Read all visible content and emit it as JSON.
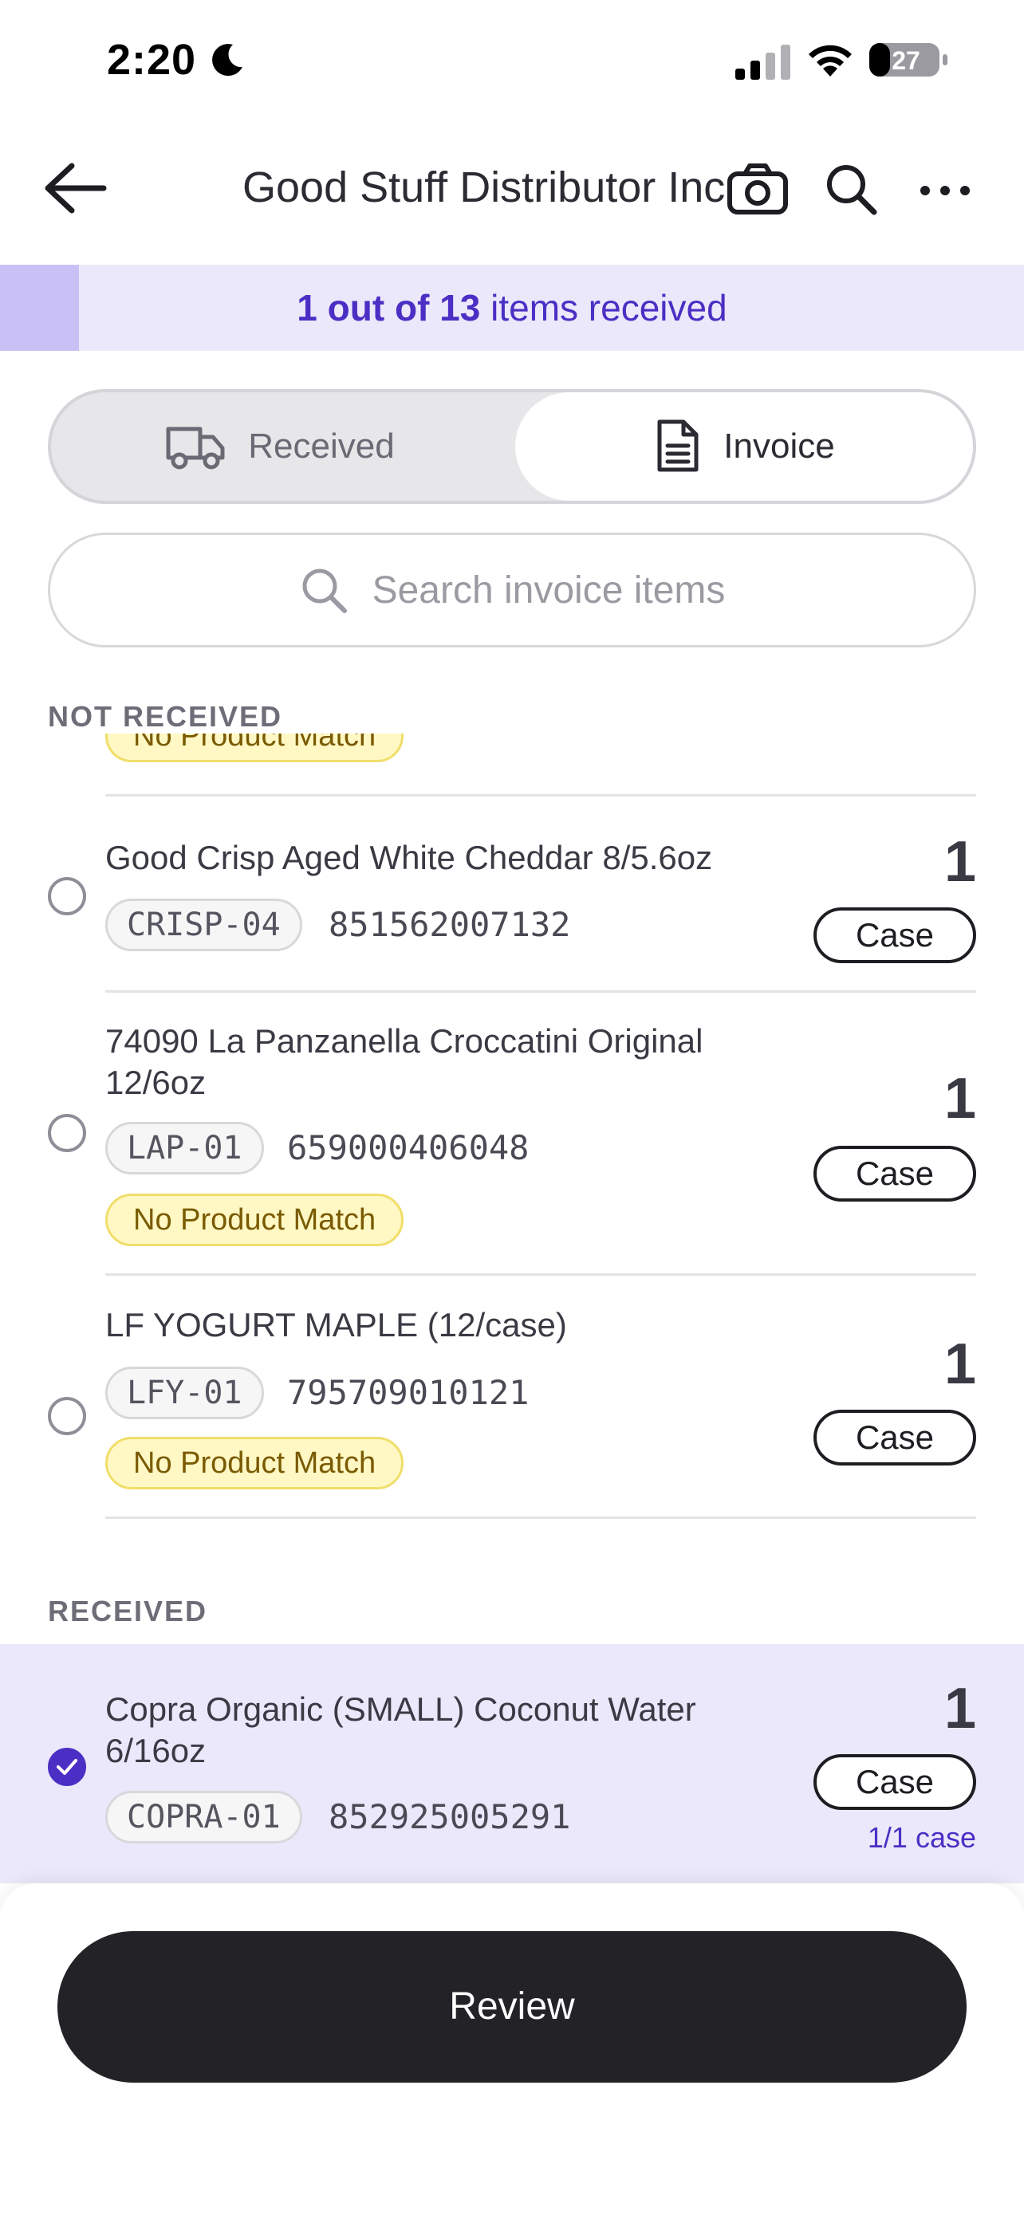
{
  "status_bar": {
    "time": "2:20",
    "battery": "27"
  },
  "nav": {
    "title": "Good Stuff Distributor Inc."
  },
  "banner": {
    "received": "1",
    "total": "13",
    "text_mid": "out of",
    "text_end": "items received",
    "progress": 0.0769
  },
  "tabs": {
    "received": "Received",
    "invoice": "Invoice",
    "selected": "invoice"
  },
  "search": {
    "placeholder": "Search invoice items"
  },
  "sections": {
    "not_received": "NOT RECEIVED",
    "received": "RECEIVED"
  },
  "partial_item": {
    "badge": "No Product Match"
  },
  "not_received_items": [
    {
      "name": "Good Crisp Aged White Cheddar 8/5.6oz",
      "sku": "CRISP-04",
      "upc": "851562007132",
      "qty": "1",
      "unit": "Case",
      "badge": ""
    },
    {
      "name": "74090 La Panzanella Croccatini Original 12/6oz",
      "sku": "LAP-01",
      "upc": "659000406048",
      "qty": "1",
      "unit": "Case",
      "badge": "No Product Match"
    },
    {
      "name": "LF YOGURT MAPLE (12/case)",
      "sku": "LFY-01",
      "upc": "795709010121",
      "qty": "1",
      "unit": "Case",
      "badge": "No Product Match"
    }
  ],
  "received_items": [
    {
      "name": "Copra Organic (SMALL) Coconut Water 6/16oz",
      "sku": "COPRA-01",
      "upc": "852925005291",
      "qty": "1",
      "unit": "Case",
      "received_count": "1/1 case"
    }
  ],
  "footer": {
    "review": "Review"
  },
  "colors": {
    "accent": "#4b2fc4",
    "banner_bg": "#ebe8fb",
    "badge_bg": "#fff8c4",
    "button_dark": "#232327"
  }
}
